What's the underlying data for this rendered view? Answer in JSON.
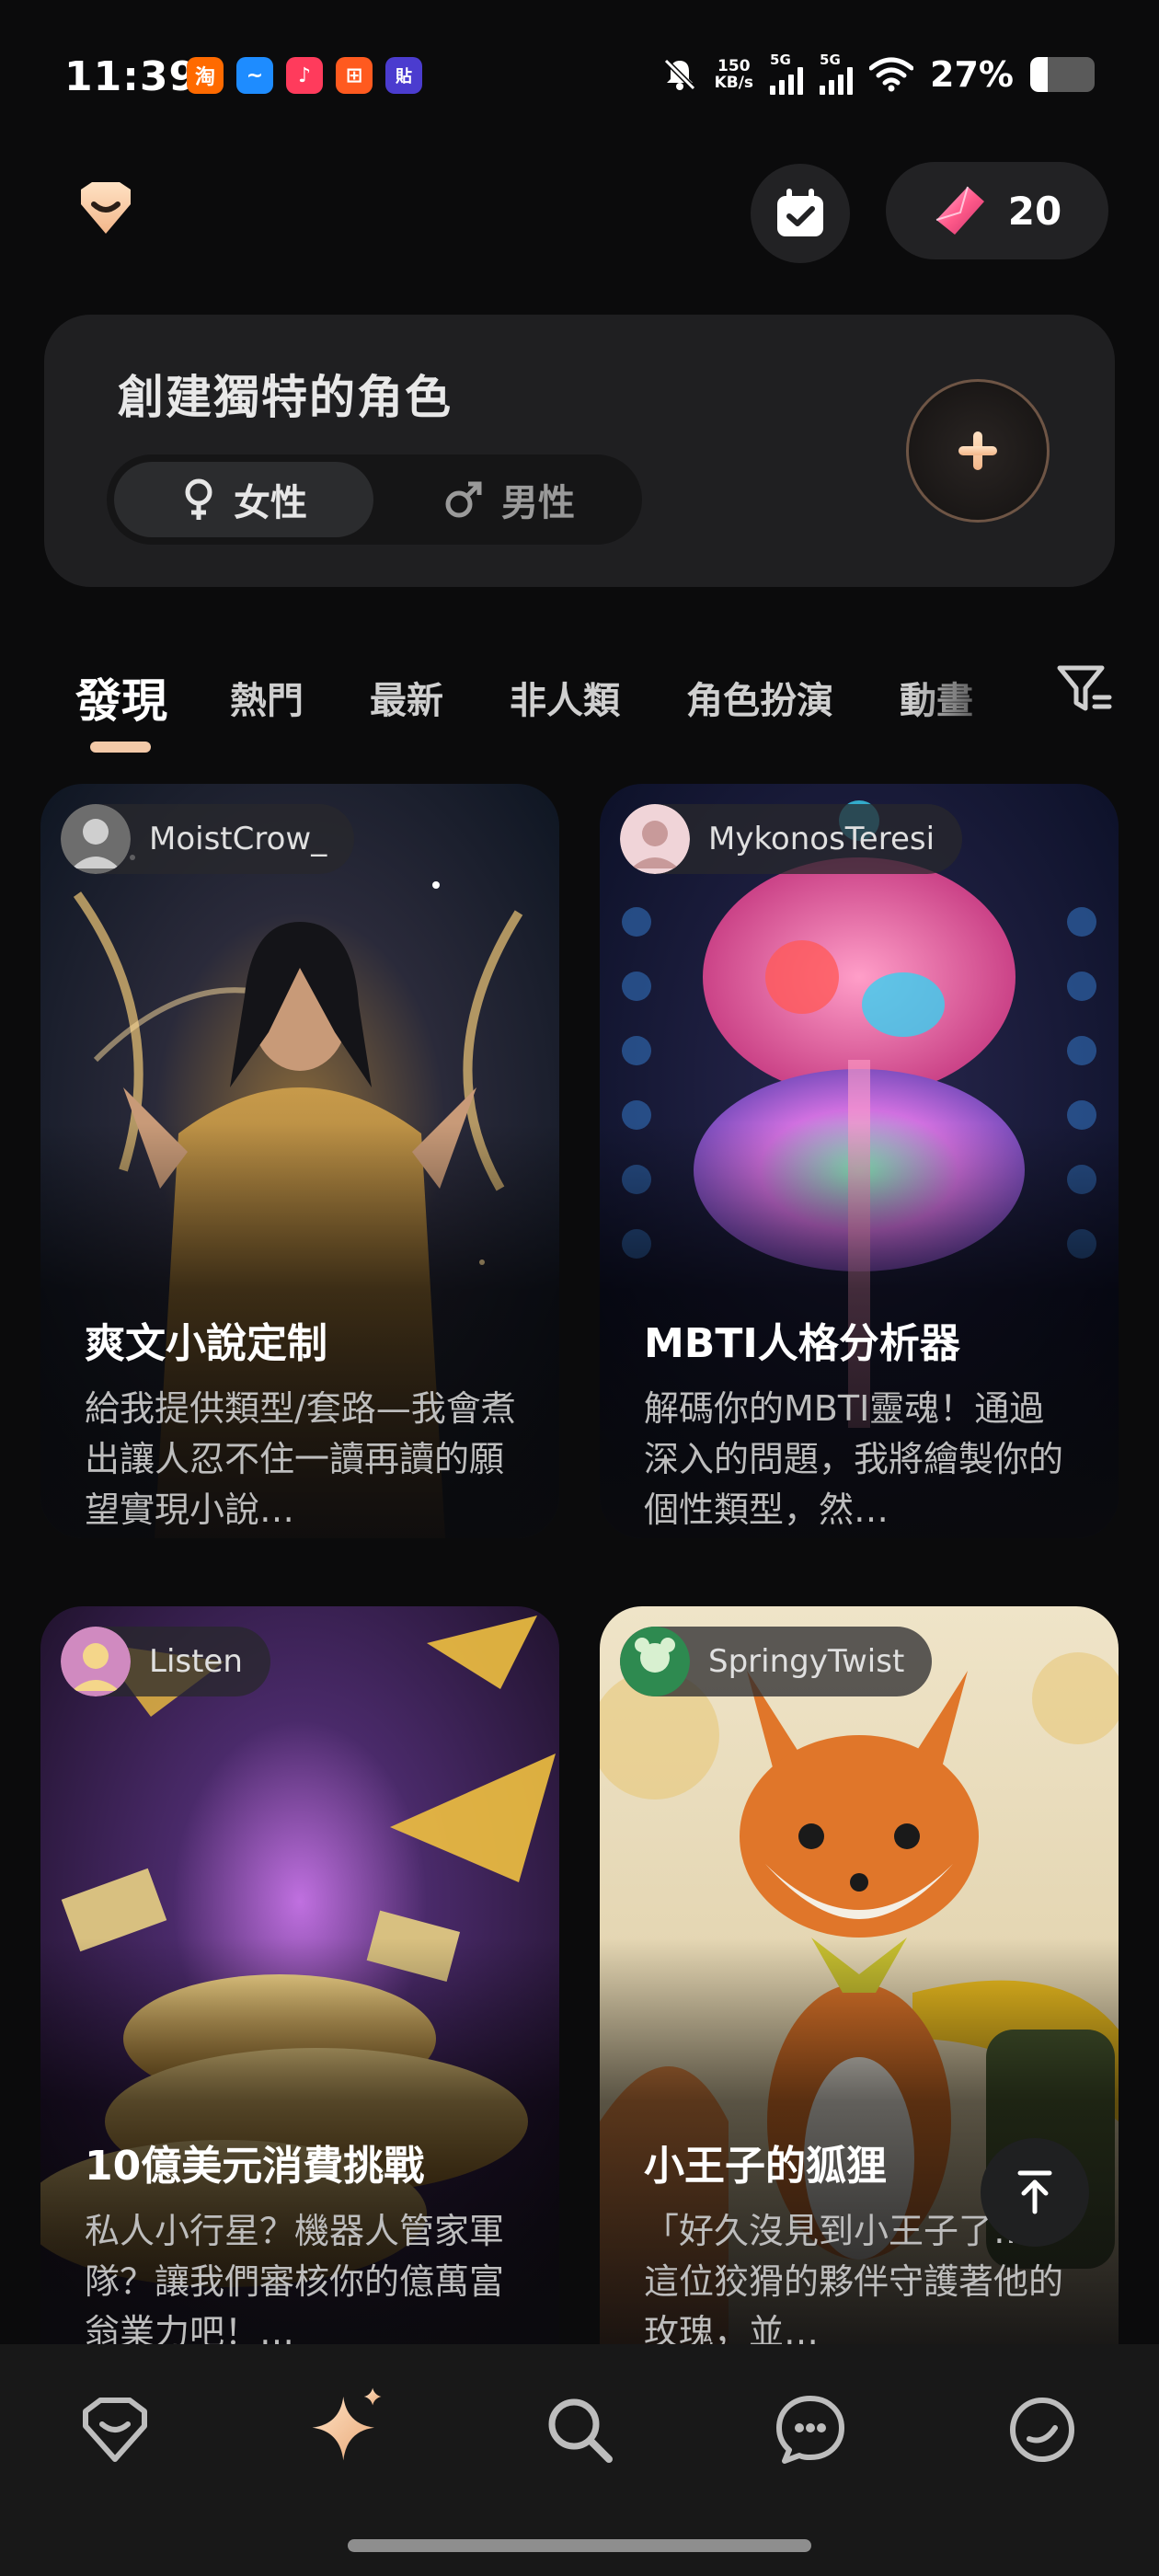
{
  "status_bar": {
    "time": "11:39",
    "app_icons": [
      {
        "glyph": "淘",
        "color": "#ff6a00",
        "name": "taobao-icon"
      },
      {
        "glyph": "~",
        "color": "#1e8cff",
        "name": "wave-app-icon"
      },
      {
        "glyph": "♪",
        "color": "#ff3b5c",
        "name": "music-app-icon"
      },
      {
        "glyph": "⊞",
        "color": "#ff5a1f",
        "name": "grid-app-icon"
      },
      {
        "glyph": "貼",
        "color": "#4b3ccf",
        "name": "tieba-icon"
      }
    ],
    "net_speed_value": "150",
    "net_speed_unit": "KB/s",
    "signal1_label": "5G",
    "signal2_label": "5G",
    "battery_text": "27%",
    "battery_level": 0.27
  },
  "header": {
    "logo_icon": "heart-gem-logo",
    "calendar_icon": "calendar-check-icon",
    "gem_icon": "crystal-icon",
    "gem_count": "20"
  },
  "create": {
    "title": "創建獨特的角色",
    "female_label": "女性",
    "male_label": "男性",
    "plus_icon": "plus-icon"
  },
  "tabs": {
    "items": [
      "發現",
      "熱門",
      "最新",
      "非人類",
      "角色扮演",
      "動畫"
    ],
    "active_index": 0,
    "filter_icon": "filter-icon"
  },
  "cards": [
    {
      "creator": "MoistCrow_",
      "title": "爽文小說定制",
      "description": "給我提供類型/套路—我會煮出讓人忍不住一讀再讀的願望實現小說…"
    },
    {
      "creator": "MykonosTeresi",
      "title": "MBTI人格分析器",
      "description": "解碼你的MBTI靈魂！通過深入的問題，我將繪製你的個性類型，然…"
    },
    {
      "creator": "Listen",
      "title": "10億美元消費挑戰",
      "description": "私人小行星？機器人管家軍隊？讓我們審核你的億萬富翁業力吧！…"
    },
    {
      "creator": "SpringyTwist",
      "title": "小王子的狐狸",
      "description": "「好久沒見到小王子了…」這位狡猾的夥伴守護著他的玫瑰，並…"
    }
  ],
  "bottom_nav": {
    "items": [
      "heart-home-icon",
      "sparkle-discover-icon",
      "search-icon",
      "chat-icon",
      "profile-icon"
    ],
    "active_index": 1,
    "accent": "#f3c9a8"
  }
}
